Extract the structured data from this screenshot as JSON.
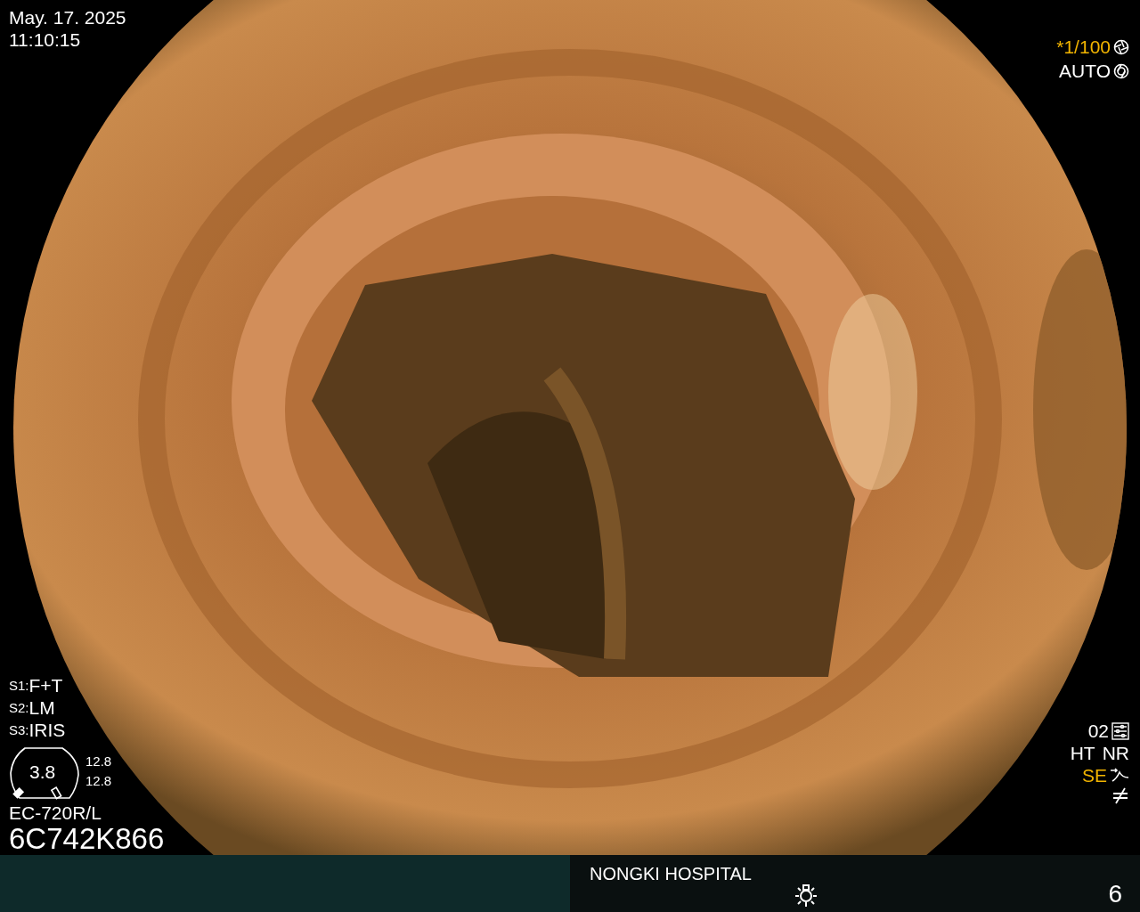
{
  "date": "May. 17. 2025",
  "time": "11:10:15",
  "shutter": {
    "value": "*1/100",
    "active": true
  },
  "exposure": {
    "value": "AUTO",
    "active": false
  },
  "switches": [
    {
      "label": "S1:",
      "value": "F+T"
    },
    {
      "label": "S2:",
      "value": "LM"
    },
    {
      "label": "S3:",
      "value": "IRIS"
    }
  ],
  "gauge": {
    "value": "3.8",
    "readings": [
      "12.8",
      "12.8"
    ]
  },
  "scope_model": "EC-720R/L",
  "serial": "6C742K866",
  "modes": {
    "preset": "02",
    "items": [
      {
        "label": "HT",
        "active": false
      },
      {
        "label": "NR",
        "active": false
      },
      {
        "label": "SE",
        "active": true
      }
    ]
  },
  "footer": {
    "hospital": "NONGKI HOSPITAL",
    "page": "6"
  }
}
